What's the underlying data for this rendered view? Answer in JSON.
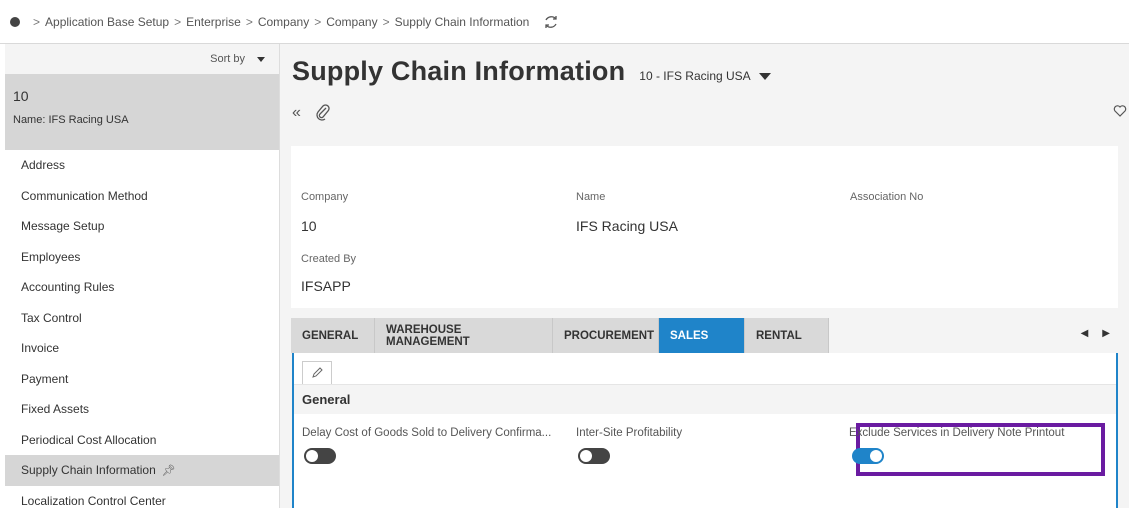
{
  "breadcrumb": {
    "items": [
      "Application Base Setup",
      "Enterprise",
      "Company",
      "Company",
      "Supply Chain Information"
    ]
  },
  "sidebar": {
    "sort_label": "Sort by",
    "record_id": "10",
    "record_name": "Name:  IFS Racing USA",
    "items": [
      {
        "label": "Address"
      },
      {
        "label": "Communication Method"
      },
      {
        "label": "Message Setup"
      },
      {
        "label": "Employees"
      },
      {
        "label": "Accounting Rules"
      },
      {
        "label": "Tax Control"
      },
      {
        "label": "Invoice"
      },
      {
        "label": "Payment"
      },
      {
        "label": "Fixed Assets"
      },
      {
        "label": "Periodical Cost Allocation"
      },
      {
        "label": "Supply Chain Information",
        "active": true
      },
      {
        "label": "Localization Control Center"
      }
    ]
  },
  "header": {
    "title": "Supply Chain Information",
    "record_selector": "10 - IFS Racing USA"
  },
  "details": {
    "company_label": "Company",
    "company_value": "10",
    "name_label": "Name",
    "name_value": "IFS Racing USA",
    "association_label": "Association No",
    "created_by_label": "Created By",
    "created_by_value": "IFSAPP"
  },
  "tabs": [
    {
      "label": "GENERAL"
    },
    {
      "label": "WAREHOUSE MANAGEMENT"
    },
    {
      "label": "PROCUREMENT"
    },
    {
      "label": "SALES",
      "selected": true
    },
    {
      "label": "RENTAL"
    }
  ],
  "sales": {
    "group_title": "General",
    "delay_cogs_label": "Delay Cost of Goods Sold to Delivery Confirma...",
    "delay_cogs_on": false,
    "inter_site_label": "Inter-Site Profitability",
    "inter_site_on": false,
    "exclude_services_label": "Exclude Services in Delivery Note Printout",
    "exclude_services_on": true
  },
  "colors": {
    "accent": "#1f84c9",
    "highlight": "#6a1ba1"
  },
  "icons": {
    "refresh": "refresh-icon",
    "collapse": "double-chevron-left-icon",
    "attach": "paperclip-icon",
    "favorite": "heart-icon",
    "edit": "pencil-icon",
    "pin": "pin-icon"
  }
}
